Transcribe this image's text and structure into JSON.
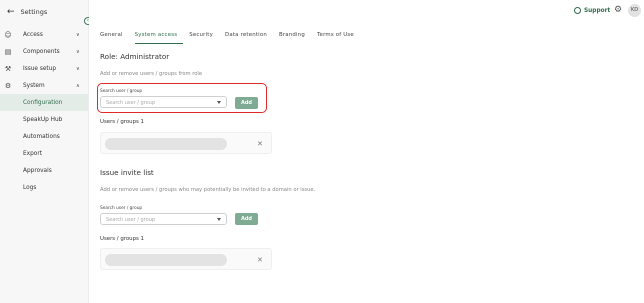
{
  "header": {
    "back_icon": "arrow-left-icon",
    "title": "Settings"
  },
  "sidebar": {
    "items": [
      {
        "label": "Access",
        "icon": "users-icon",
        "expandable": true,
        "expanded": false
      },
      {
        "label": "Components",
        "icon": "database-icon",
        "expandable": true,
        "expanded": false
      },
      {
        "label": "Issue setup",
        "icon": "tools-icon",
        "expandable": true,
        "expanded": false
      },
      {
        "label": "System",
        "icon": "gear-icon",
        "expandable": true,
        "expanded": true
      },
      {
        "label": "Configuration",
        "sub": true,
        "active": true
      },
      {
        "label": "SpeakUp Hub",
        "sub": true
      },
      {
        "label": "Automations",
        "sub": true
      },
      {
        "label": "Export",
        "sub": true
      },
      {
        "label": "Approvals",
        "sub": true
      },
      {
        "label": "Logs",
        "sub": true
      }
    ]
  },
  "topbar": {
    "support_label": "Support",
    "avatar_initials": "KD"
  },
  "tabs": [
    "General",
    "System access",
    "Security",
    "Data retention",
    "Branding",
    "Terms of Use"
  ],
  "active_tab": "System access",
  "role_section": {
    "title": "Role: Administrator",
    "description": "Add or remove users / groups from role",
    "field_label": "Search user / group",
    "placeholder": "Search user / group",
    "add_label": "Add",
    "users_label": "Users / groups 1"
  },
  "invite_section": {
    "title": "Issue invite list",
    "description": "Add or remove users / groups who may potentially be invited to a domain or issue.",
    "field_label": "Search user / group",
    "placeholder": "Search user / group",
    "add_label": "Add",
    "users_label": "Users / groups 1"
  },
  "colors": {
    "accent": "#2f6d4b",
    "button": "#7fab95",
    "highlight": "#e02a2a"
  }
}
